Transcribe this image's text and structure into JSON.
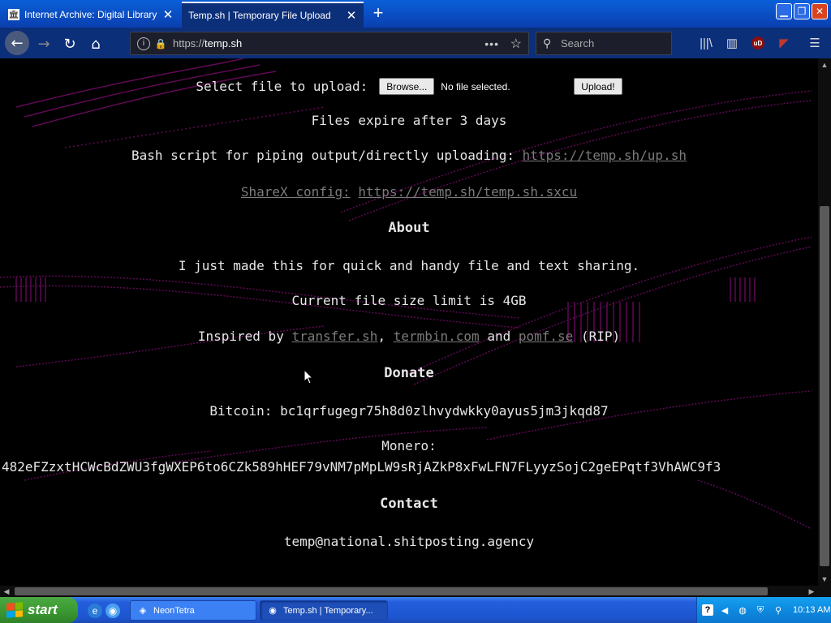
{
  "browser": {
    "tabs": [
      {
        "title": "Internet Archive: Digital Library of",
        "favicon": "archive-icon",
        "active": false
      },
      {
        "title": "Temp.sh | Temporary File Upload",
        "active": true
      }
    ],
    "new_tab": "+",
    "url_prefix": "https://",
    "url_host": "temp.sh",
    "search_placeholder": "Search",
    "page_actions": "•••",
    "ublock_label": "uD"
  },
  "page": {
    "select_label": "Select file to upload:",
    "browse_label": "Browse...",
    "no_file_text": "No file selected.",
    "upload_label": "Upload!",
    "expire_text": "Files expire after 3 days",
    "bash_text": "Bash script for piping output/directly uploading:",
    "bash_link": "https://temp.sh/up.sh",
    "sharex_label": "ShareX config:",
    "sharex_link": "https://temp.sh/temp.sh.sxcu",
    "about_heading": "About",
    "about_text": "I just made this for quick and handy file and text sharing.",
    "limit_text": "Current file size limit is 4GB",
    "inspired_prefix": "Inspired by",
    "inspired_link1": "transfer.sh",
    "inspired_sep1": ",",
    "inspired_link2": "termbin.com",
    "inspired_and": "and",
    "inspired_link3": "pomf.se",
    "inspired_rip": "(RIP)",
    "donate_heading": "Donate",
    "bitcoin_label": "Bitcoin:",
    "bitcoin_address": "bc1qrfugegr75h8d0zlhvydwkky0ayus5jm3jkqd87",
    "monero_label": "Monero:",
    "monero_address": "482eFZzxtHCWcBdZWU3fgWXEP6to6CZk589hHEF79vNM7pMpLW9sRjAZkP8xFwLFN7FLyyzSojC2geEPqtf3VhAWC9f3",
    "contact_heading": "Contact",
    "contact_email": "temp@national.shitposting.agency"
  },
  "taskbar": {
    "start_label": "start",
    "tasks": [
      {
        "title": "NeonTetra",
        "active": false
      },
      {
        "title": "Temp.sh | Temporary...",
        "active": true
      }
    ],
    "clock": "10:13 AM"
  },
  "colors": {
    "background": "#000000",
    "text": "#e6e6e6",
    "link": "#7b7b7b",
    "decoration": "#b0119a",
    "tab_bar": "#0a4fc6",
    "xp_start": "#3c9a33"
  }
}
